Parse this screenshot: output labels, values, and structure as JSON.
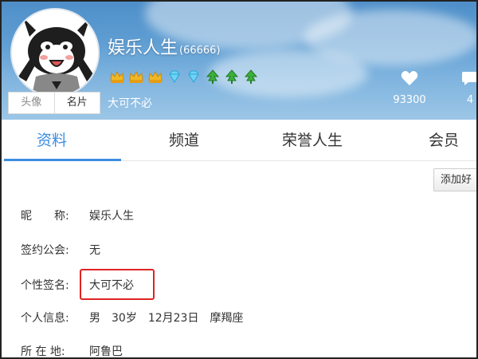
{
  "profile": {
    "nickname": "娱乐人生",
    "uid": "(66666)",
    "motto": "大可不必",
    "avatar_tabs": [
      "头像",
      "名片"
    ]
  },
  "stats": [
    {
      "icon": "heart-icon",
      "value": "93300"
    },
    {
      "icon": "comment-icon",
      "value": "4"
    }
  ],
  "badges": [
    "crown-icon",
    "crown-icon",
    "crown-icon",
    "diamond-icon",
    "diamond-icon",
    "leaf-icon",
    "leaf-icon",
    "leaf-icon"
  ],
  "tabs": [
    "资料",
    "频道",
    "荣誉人生",
    "会员"
  ],
  "actions": {
    "add_friend": "添加好"
  },
  "info": [
    {
      "label": "昵　　称:",
      "value": "娱乐人生"
    },
    {
      "label": "签约公会:",
      "value": "无"
    },
    {
      "label": "个性签名:",
      "value": "大可不必"
    },
    {
      "label": "个人信息:",
      "values": [
        "男",
        "30岁",
        "12月23日",
        "摩羯座"
      ]
    },
    {
      "label": "所 在 地:",
      "value": "阿鲁巴"
    }
  ],
  "colors": {
    "accent": "#3c8ee0",
    "highlight": "#e02424",
    "banner": "#5f9ed3"
  }
}
